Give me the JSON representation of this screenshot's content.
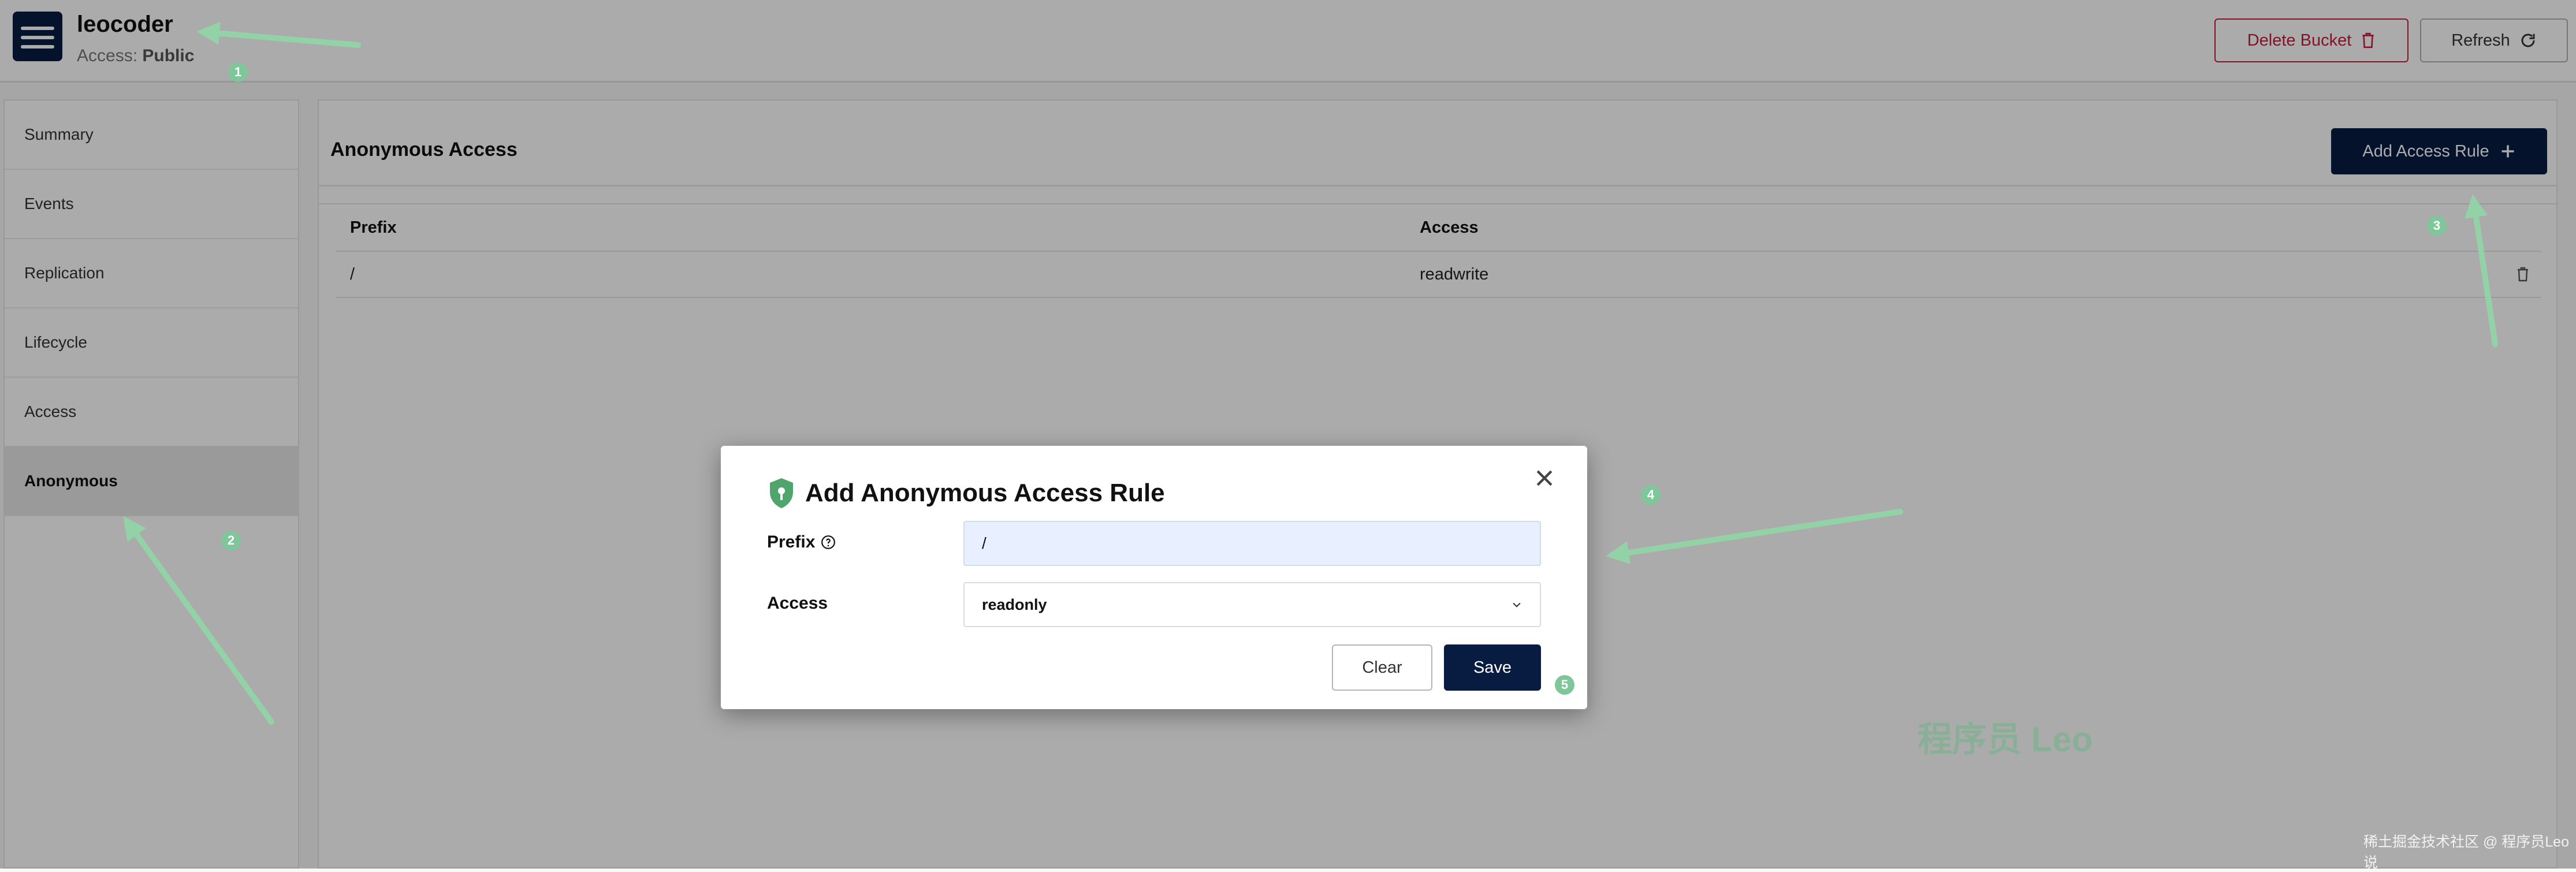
{
  "header": {
    "bucket_name": "leocoder",
    "access_label": "Access:",
    "access_value": "Public",
    "delete_button": "Delete Bucket",
    "refresh_button": "Refresh"
  },
  "sidebar": {
    "items": [
      {
        "label": "Summary"
      },
      {
        "label": "Events"
      },
      {
        "label": "Replication"
      },
      {
        "label": "Lifecycle"
      },
      {
        "label": "Access"
      },
      {
        "label": "Anonymous",
        "active": true
      }
    ]
  },
  "main": {
    "title": "Anonymous Access",
    "add_button": "Add Access Rule",
    "table": {
      "columns": [
        "Prefix",
        "Access"
      ],
      "rows": [
        {
          "prefix": "/",
          "access": "readwrite"
        }
      ]
    }
  },
  "modal": {
    "title": "Add Anonymous Access Rule",
    "prefix_label": "Prefix",
    "prefix_value": "/",
    "access_label": "Access",
    "access_value": "readonly",
    "clear_button": "Clear",
    "save_button": "Save"
  },
  "annotations": [
    "1",
    "2",
    "3",
    "4",
    "5"
  ],
  "watermark": "程序员 Leo",
  "footer_mark": "稀土掘金技术社区 @ 程序员Leo说",
  "colors": {
    "primary": "#081c42",
    "danger": "#c51b3c",
    "annotation": "#7fc79a",
    "input_bg": "#e8efff"
  }
}
